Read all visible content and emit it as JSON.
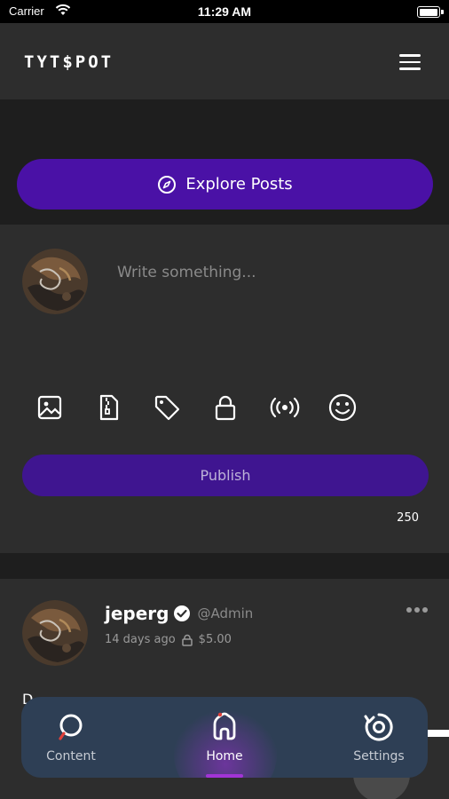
{
  "status_bar": {
    "carrier": "Carrier",
    "time": "11:29 AM",
    "battery_level": 0.9
  },
  "header": {
    "logo": "TYT$POT"
  },
  "explore": {
    "label": "Explore Posts"
  },
  "composer": {
    "placeholder": "Write something...",
    "tools": [
      "image-icon",
      "file-zip-icon",
      "tag-icon",
      "lock-icon",
      "broadcast-icon",
      "smile-icon"
    ],
    "publish_label": "Publish",
    "char_count": "250"
  },
  "post": {
    "author": "jeperg",
    "handle": "@Admin",
    "time": "14 days ago",
    "price": "$5.00",
    "text": "D..."
  },
  "nav": {
    "items": [
      {
        "label": "Content",
        "icon": "search-icon"
      },
      {
        "label": "Home",
        "icon": "home-icon",
        "active": true
      },
      {
        "label": "Settings",
        "icon": "settings-icon"
      }
    ]
  },
  "colors": {
    "accent": "#4a11a6",
    "publish": "#3f1590",
    "surface": "#2d2d2d",
    "background": "#1e1e1e",
    "nav": "#2e3f55",
    "nav_indicator": "#a234d6"
  }
}
